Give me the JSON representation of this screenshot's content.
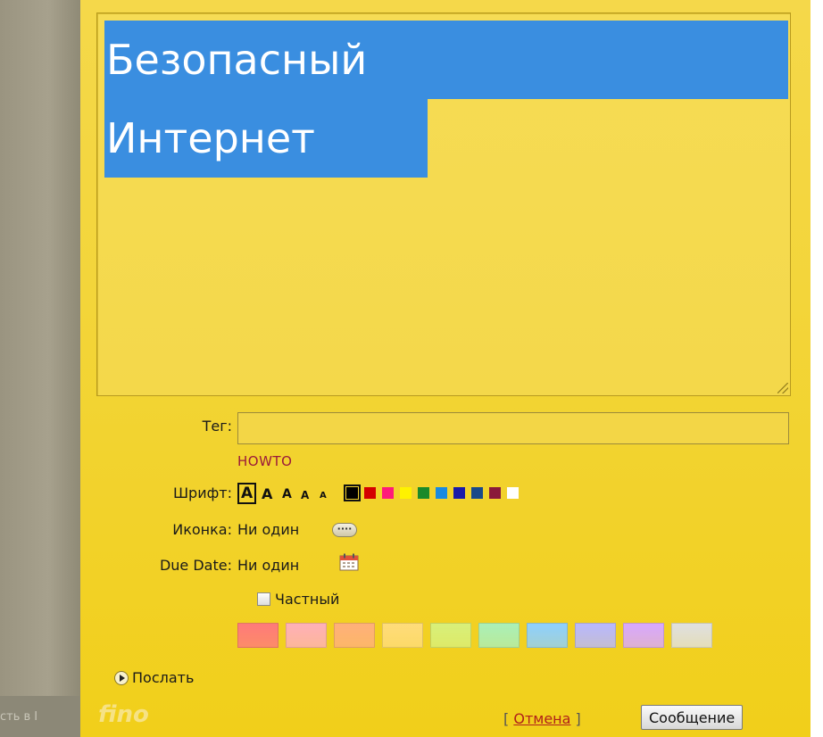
{
  "background_left_text": "сть в I",
  "note": {
    "content_lines": [
      "Безопасный",
      "Интернет"
    ],
    "fields": {
      "tag_label": "Тег:",
      "tag_value": "",
      "tag_suggestion": "HOWTO",
      "font_label": "Шрифт:",
      "font_sizes": [
        "A",
        "A",
        "A",
        "A",
        "A"
      ],
      "text_colors": [
        "#000000",
        "#d40000",
        "#ff1a7a",
        "#fff200",
        "#1a8a2a",
        "#1a8ae0",
        "#1a1aa8",
        "#1a4a8a",
        "#8a1a3a",
        "#ffffff"
      ],
      "icon_label": "Иконка:",
      "icon_value": "Ни один",
      "icon_button_glyph": "····",
      "due_date_label": "Due Date:",
      "due_date_value": "Ни один",
      "private_label": "Частный",
      "note_colors": [
        "#ff7a7a",
        "#ffb0b8",
        "#ffb07a",
        "#ffdc7a",
        "#d8f07a",
        "#aaf0b8",
        "#8ed0ff",
        "#b8b8ff",
        "#d8a8ff",
        "#e0e0e0"
      ]
    },
    "send_label": "Послать",
    "cancel_open": "[",
    "cancel_label": "Отмена",
    "cancel_close": "]",
    "submit_label": "Сообщение",
    "watermark": "fino"
  }
}
